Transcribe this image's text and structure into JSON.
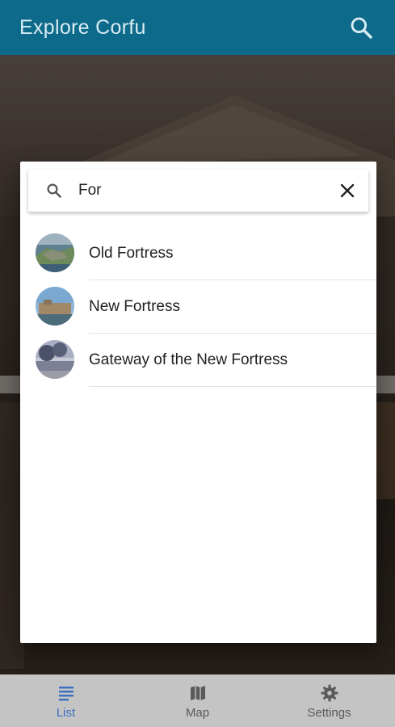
{
  "app_bar": {
    "title": "Explore Corfu",
    "search_icon": "search-icon"
  },
  "search": {
    "query": "For",
    "search_icon": "search-icon",
    "clear_icon": "close-icon"
  },
  "results": [
    {
      "label": "Old Fortress"
    },
    {
      "label": "New Fortress"
    },
    {
      "label": "Gateway of the New Fortress"
    }
  ],
  "bottom_nav": {
    "items": [
      {
        "label": "List",
        "icon": "list-icon",
        "active": true
      },
      {
        "label": "Map",
        "icon": "map-icon",
        "active": false
      },
      {
        "label": "Settings",
        "icon": "gear-icon",
        "active": false
      }
    ]
  },
  "colors": {
    "app_bar": "#0e6a8a",
    "accent": "#3a6fc2",
    "nav_background": "#c4c4c4"
  }
}
